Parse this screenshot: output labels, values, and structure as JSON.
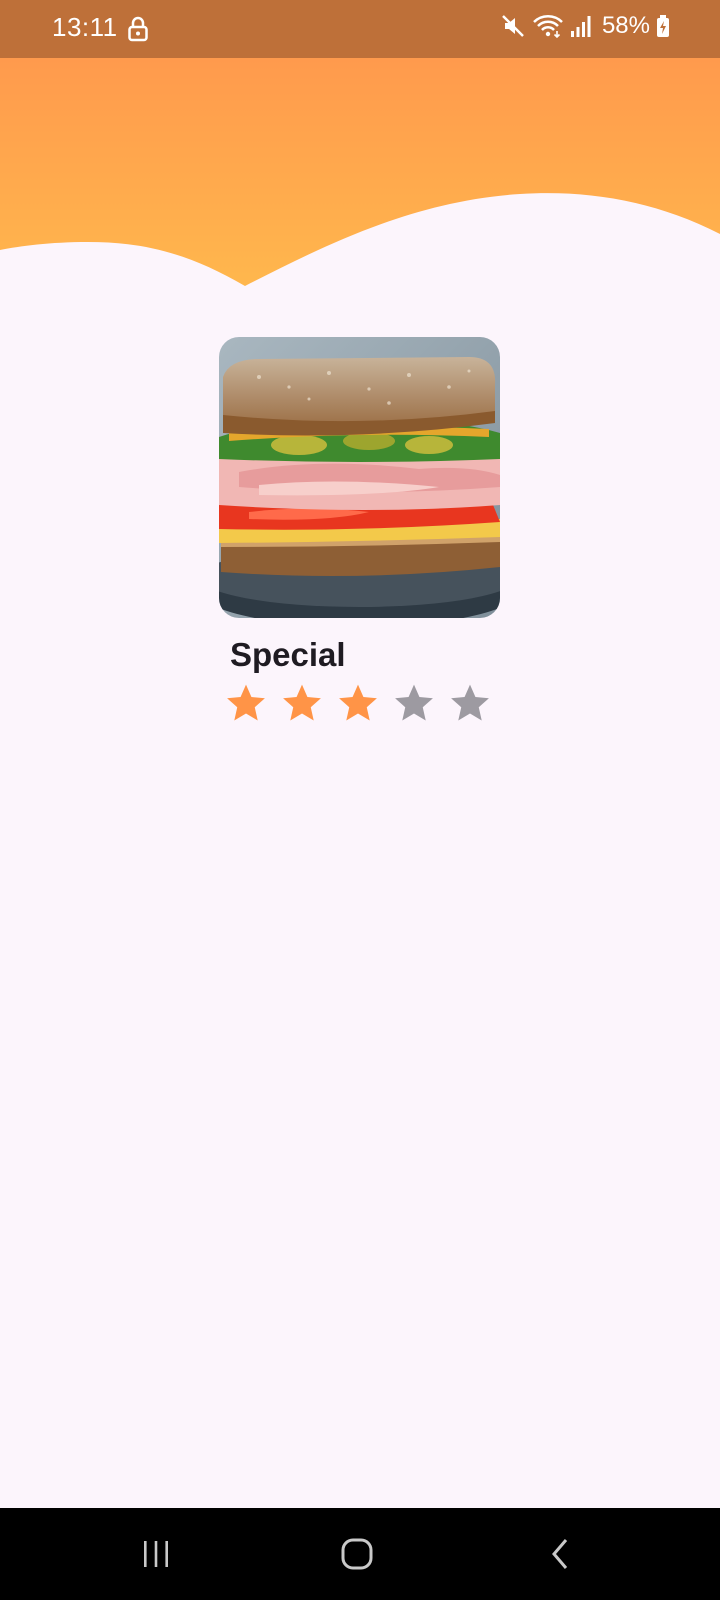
{
  "status_bar": {
    "time": "13:11",
    "battery": "58%",
    "icons": [
      "lock-icon",
      "mute-icon",
      "wifi-icon",
      "signal-icon",
      "battery-charging-icon"
    ]
  },
  "theme": {
    "header_gradient": [
      "#FF9A4D",
      "#FFB74D"
    ],
    "background": "#FCF5FC",
    "status_bar": "#BE7039",
    "star_filled": "#FF9447",
    "star_empty": "#9D9AA1"
  },
  "item": {
    "title": "Special",
    "image_icon": "sandwich-image",
    "rating": 3,
    "rating_max": 5
  },
  "nav_bar": {
    "buttons": [
      "recent-apps",
      "home",
      "back"
    ]
  }
}
